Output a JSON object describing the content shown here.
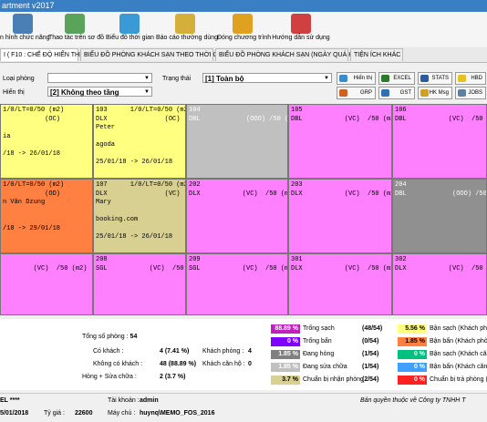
{
  "window": {
    "title": "artment v2017"
  },
  "toolbar": [
    {
      "label": "n hình chức năng",
      "icon": "monitor-icon",
      "color": "#4a7fb5"
    },
    {
      "label": "Thao tác trên sơ đồ",
      "icon": "map-icon",
      "color": "#5aa35a"
    },
    {
      "label": "Biểu đồ thời gian",
      "icon": "calendar-icon",
      "color": "#3a9ad6"
    },
    {
      "label": "Báo cáo thường dùng",
      "icon": "report-icon",
      "color": "#d4b03a"
    },
    {
      "label": "Đóng chương trình",
      "icon": "lock-icon",
      "color": "#e0a020"
    },
    {
      "label": "Hướng dẫn sử dụng",
      "icon": "help-icon",
      "color": "#d04040"
    }
  ],
  "tabs": [
    "I ( F10 : CHẾ ĐỘ HIỂN THỊ )",
    "BIỂU ĐỒ PHÒNG KHÁCH SẠN THEO THỜI GIAN",
    "BIỂU ĐỒ PHÒNG KHÁCH SẠN (NGÀY QUÁ KHỨ)",
    "TIỆN ÍCH KHÁC"
  ],
  "filters": {
    "room_type_label": "Loại phòng",
    "room_type_value": "",
    "display_label": "Hiển thị",
    "display_value": "[2] Không theo tầng",
    "status_label": "Trạng thái",
    "status_value": "[1] Toàn bộ"
  },
  "actions": [
    {
      "label": "Hiển thị",
      "icon": "refresh-icon",
      "color": "#3a8ad0"
    },
    {
      "label": "EXCEL",
      "icon": "excel-icon",
      "color": "#2a7a2a"
    },
    {
      "label": "STATS",
      "icon": "stats-icon",
      "color": "#2a5aa0"
    },
    {
      "label": "HBD",
      "icon": "bulb-icon",
      "color": "#e8c020"
    },
    {
      "label": "GRP",
      "icon": "group-icon",
      "color": "#d06020"
    },
    {
      "label": "GST",
      "icon": "guest-icon",
      "color": "#3070b0"
    },
    {
      "label": "HK Msg",
      "icon": "message-icon",
      "color": "#d0a020"
    },
    {
      "label": "JOBS",
      "icon": "jobs-icon",
      "color": "#6080a0"
    }
  ],
  "rooms": [
    {
      "lines": [
        "1/0/LT=0/50 (m2)",
        "           (OC)",
        "",
        "ia",
        "",
        "/18 -> 26/01/18"
      ],
      "bg": "#ffff80"
    },
    {
      "lines": [
        "103      1/0/LT=0/50 (m2)",
        "DLX               (OC)",
        "Peter",
        "",
        "agoda",
        "",
        "25/01/18 -> 26/01/18"
      ],
      "bg": "#ffff80"
    },
    {
      "lines": [
        "104",
        "DBL            (OOO) /50 (m2)"
      ],
      "bg": "#c0c0c0",
      "light": true
    },
    {
      "lines": [
        "105",
        "DBL           (VC)  /50 (m2)"
      ],
      "bg": "#ff80ff"
    },
    {
      "lines": [
        "106",
        "DBL           (VC)  /50 (m2)"
      ],
      "bg": "#ff80ff"
    },
    {
      "lines": [
        "1/0/LT=0/50 (m2)",
        "           (OD)",
        "n Văn Dzung",
        "",
        "",
        "/18 -> 29/01/18"
      ],
      "bg": "#ff8040"
    },
    {
      "lines": [
        "107      1/0/LT=0/50 (m2)",
        "DLX               (VC)",
        "Mary",
        "",
        "booking.com",
        "",
        "25/01/18 -> 26/01/18"
      ],
      "bg": "#d8d090"
    },
    {
      "lines": [
        "202",
        "DLX           (VC)  /50 (m2)"
      ],
      "bg": "#ff80ff"
    },
    {
      "lines": [
        "203",
        "DLX           (VC)  /50 (m2)"
      ],
      "bg": "#ff80ff"
    },
    {
      "lines": [
        "204",
        "DBL            (OOO) /50 (m2)"
      ],
      "bg": "#909090",
      "light": true
    },
    {
      "lines": [
        "",
        "        (VC)  /50 (m2)"
      ],
      "bg": "#ff80ff"
    },
    {
      "lines": [
        "208",
        "SGL           (VC)  /50 (m2)"
      ],
      "bg": "#ff80ff"
    },
    {
      "lines": [
        "209",
        "SGL           (VC)  /50 (m2)"
      ],
      "bg": "#ff80ff"
    },
    {
      "lines": [
        "301",
        "DLX           (VC)  /50 (m2)"
      ],
      "bg": "#ff80ff"
    },
    {
      "lines": [
        "302",
        "DLX           (VC)  /50 (m2)"
      ],
      "bg": "#ff80ff"
    }
  ],
  "stats": {
    "total_label": "Tổng số phòng :",
    "total_value": "54",
    "has_guest_label": "Có khách :",
    "has_guest_value": "4 (7.41 %)",
    "guest_label": "Khách phòng :",
    "guest_value": "4",
    "no_guest_label": "Không có khách :",
    "no_guest_value": "48 (88.89 %)",
    "guest_room_label": "Khách căn hộ :",
    "guest_room_value": "0",
    "broken_label": "Hỏng + Sửa chữa :",
    "broken_value": "2 (3.7 %)"
  },
  "legend_left": [
    {
      "pct": "88.89 %",
      "label": "Trống sạch",
      "count": "(48/54)",
      "color": "#c020c0"
    },
    {
      "pct": "0 %",
      "label": "Trống bẩn",
      "count": "(0/54)",
      "color": "#8000ff"
    },
    {
      "pct": "1.85 %",
      "label": "Đang hỏng",
      "count": "(1/54)",
      "color": "#808080"
    },
    {
      "pct": "1.85 %",
      "label": "Đang sửa chữa",
      "count": "(1/54)",
      "color": "#c0c0c0"
    },
    {
      "pct": "3.7 %",
      "label": "Chuẩn bị nhận phòng",
      "count": "(2/54)",
      "color": "#d8d090",
      "dark": true
    }
  ],
  "legend_right": [
    {
      "pct": "5.56 %",
      "label": "Bận sạch (Khách phòng)",
      "color": "#ffff80",
      "dark": true
    },
    {
      "pct": "1.85 %",
      "label": "Bận bẩn (Khách phòng)",
      "color": "#ff8040",
      "dark": true
    },
    {
      "pct": "0 %",
      "label": "Bận sạch (Khách căn hộ)",
      "color": "#00c080"
    },
    {
      "pct": "0 %",
      "label": "Bận bẩn (Khách căn hộ)",
      "color": "#40a0ff"
    },
    {
      "pct": "0 %",
      "label": "Chuẩn bị trả phòng (ED)",
      "color": "#ff2020"
    }
  ],
  "status": {
    "hotel": "EL ****",
    "account_label": "Tài khoản :",
    "account_value": "admin",
    "copyright": "Bản quyền thuộc về Công ty TNHH T",
    "date": "5/01/2018",
    "rate_label": "Tỷ giá :",
    "rate_value": "22600",
    "machine_label": "Máy chủ :",
    "machine_value": "huynq\\MEMO_FOS_2016"
  }
}
